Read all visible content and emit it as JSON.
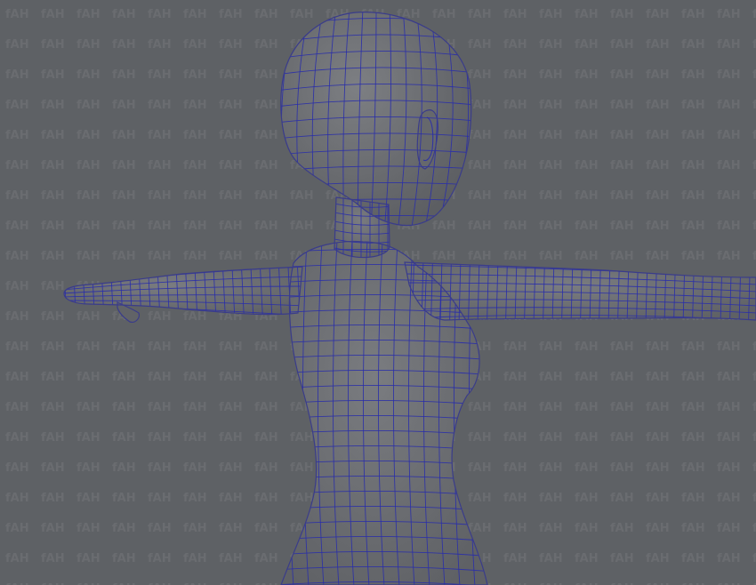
{
  "viewport": {
    "background_color": "#5e6165",
    "mesh_shade_color": "#6e7074",
    "wireframe_color": "#2a2fa8"
  },
  "model": {
    "kind": "polygon-mesh",
    "display_mode": "wireframe-on-shaded",
    "pose": "T-pose"
  },
  "watermark": {
    "text": "fAH",
    "tiled": true
  }
}
